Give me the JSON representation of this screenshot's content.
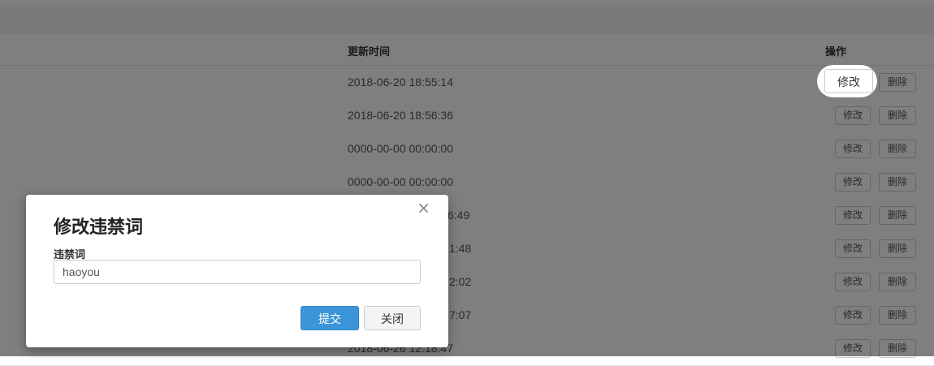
{
  "table": {
    "headers": {
      "updated_time": "更新时间",
      "operations": "操作"
    },
    "rows": [
      {
        "updated_time": "2018-06-20 18:55:14",
        "edit_label": "修改",
        "delete_label": "删除"
      },
      {
        "updated_time": "2018-06-20 18:56:36",
        "edit_label": "修改",
        "delete_label": "删除"
      },
      {
        "updated_time": "0000-00-00 00:00:00",
        "edit_label": "修改",
        "delete_label": "删除"
      },
      {
        "updated_time": "0000-00-00 00:00:00",
        "edit_label": "修改",
        "delete_label": "删除"
      },
      {
        "updated_time": "6:49",
        "edit_label": "修改",
        "delete_label": "删除"
      },
      {
        "updated_time": "1:48",
        "edit_label": "修改",
        "delete_label": "删除"
      },
      {
        "updated_time": "2:02",
        "edit_label": "修改",
        "delete_label": "删除"
      },
      {
        "updated_time": "7:07",
        "edit_label": "修改",
        "delete_label": "删除"
      },
      {
        "updated_time": "2018-06-26 12:18:47",
        "edit_label": "修改",
        "delete_label": "删除"
      }
    ]
  },
  "modal": {
    "title": "修改违禁词",
    "field_label": "违禁词",
    "field_value": "haoyou",
    "close_icon": "×",
    "submit_label": "提交",
    "close_label": "关闭"
  },
  "colors": {
    "primary": "#3b95d8",
    "overlay": "rgba(0,0,0,0.5)"
  }
}
